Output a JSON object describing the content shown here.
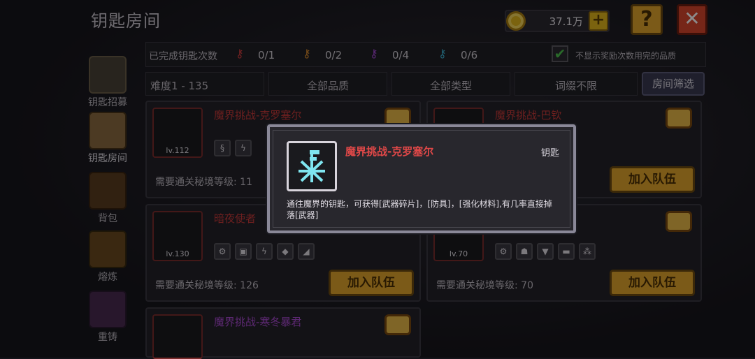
{
  "header": {
    "title": "钥匙房间",
    "coins": "37.1万",
    "plus": "+",
    "help": "?",
    "close": "✕"
  },
  "sidebar": {
    "items": [
      {
        "label": "钥匙招募",
        "icon": "gate-icon"
      },
      {
        "label": "钥匙房间",
        "icon": "key-scroll-icon"
      },
      {
        "label": "背包",
        "icon": "backpack-icon"
      },
      {
        "label": "熔炼",
        "icon": "furnace-icon"
      },
      {
        "label": "重铸",
        "icon": "anvil-icon"
      }
    ]
  },
  "stats": {
    "label": "已完成钥匙次数",
    "keys": [
      {
        "count": "0/1",
        "color": "#d23c3c"
      },
      {
        "count": "0/2",
        "color": "#d88a2c"
      },
      {
        "count": "0/4",
        "color": "#a048d0"
      },
      {
        "count": "0/6",
        "color": "#3cb0d0"
      }
    ],
    "checkbox_label": "不显示奖励次数用完的品质",
    "checked": true
  },
  "filters": {
    "difficulty": "难度1 - 135",
    "quality": "全部品质",
    "type": "全部类型",
    "affix": "词缀不限",
    "button": "房间筛选"
  },
  "cards": [
    {
      "title": "魔界挑战-克罗塞尔",
      "level": "lv.112",
      "req": "需要通关秘境等级: 11",
      "join": "加入队伍"
    },
    {
      "title": "魔界挑战-巴钦",
      "level": "",
      "req": "",
      "join": "加入队伍"
    },
    {
      "title": "暗夜使者",
      "level": "lv.130",
      "req": "需要通关秘境等级: 126",
      "join": "加入队伍"
    },
    {
      "title": "",
      "level": "lv.70",
      "req": "需要通关秘境等级: 70",
      "join": "加入队伍"
    },
    {
      "title": "魔界挑战-寒冬暴君",
      "level": "",
      "req": "",
      "join": ""
    }
  ],
  "popup": {
    "title": "魔界挑战-克罗塞尔",
    "tag": "钥匙",
    "desc": "通往魔界的钥匙，可获得[武器碎片]，[防具]，[强化材料],有几率直接掉落[武器]"
  }
}
